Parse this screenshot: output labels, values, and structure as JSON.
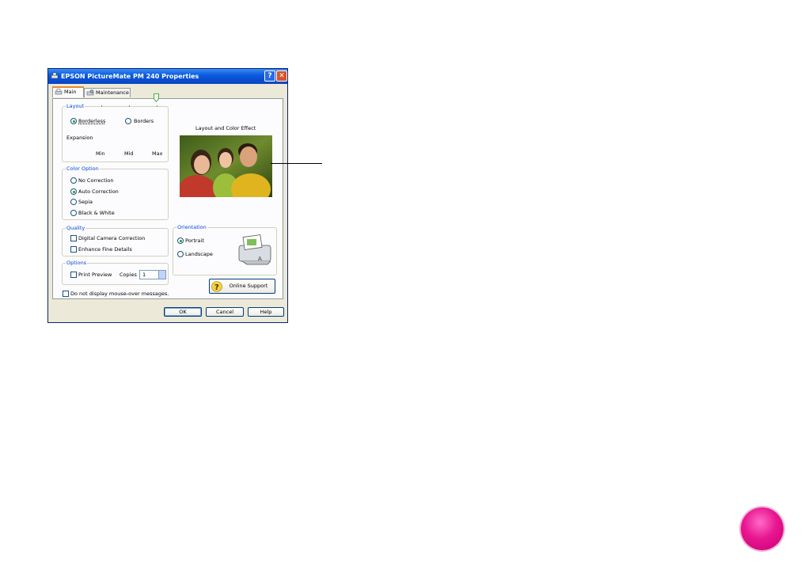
{
  "window": {
    "title": "EPSON PictureMate PM 240 Properties",
    "help_btn": "?",
    "close_btn": "✕"
  },
  "tabs": [
    {
      "label": "Main"
    },
    {
      "label": "Maintenance"
    }
  ],
  "layout_group": {
    "title": "Layout",
    "options": [
      {
        "label": "Borderless",
        "selected": true
      },
      {
        "label": "Borders",
        "selected": false
      }
    ],
    "expansion_label": "Expansion",
    "expansion_ticks": [
      "Min",
      "Mid",
      "Max"
    ],
    "expansion_value": "Max"
  },
  "preview": {
    "title": "Layout and Color Effect"
  },
  "color_group": {
    "title": "Color Option",
    "options": [
      {
        "label": "No Correction",
        "selected": false
      },
      {
        "label": "Auto Correction",
        "selected": true
      },
      {
        "label": "Sepia",
        "selected": false
      },
      {
        "label": "Black & White",
        "selected": false
      }
    ]
  },
  "quality_group": {
    "title": "Quality",
    "options": [
      {
        "label": "Digital Camera Correction",
        "checked": false
      },
      {
        "label": "Enhance Fine Details",
        "checked": false
      }
    ]
  },
  "orientation_group": {
    "title": "Orientation",
    "options": [
      {
        "label": "Portrait",
        "selected": true
      },
      {
        "label": "Landscape",
        "selected": false
      }
    ]
  },
  "options_group": {
    "title": "Options",
    "print_preview": "Print Preview",
    "copies_label": "Copies",
    "copies_value": "1"
  },
  "online_support": "Online Support",
  "mouseover_checkbox": "Do not display mouse-over messages.",
  "buttons": {
    "ok": "OK",
    "cancel": "Cancel",
    "help": "Help"
  },
  "colors": {
    "title_bar": "#0a5ce0",
    "dialog_bg": "#ece9d8",
    "group_title": "#0046d5",
    "page_button": "#e8168f"
  }
}
